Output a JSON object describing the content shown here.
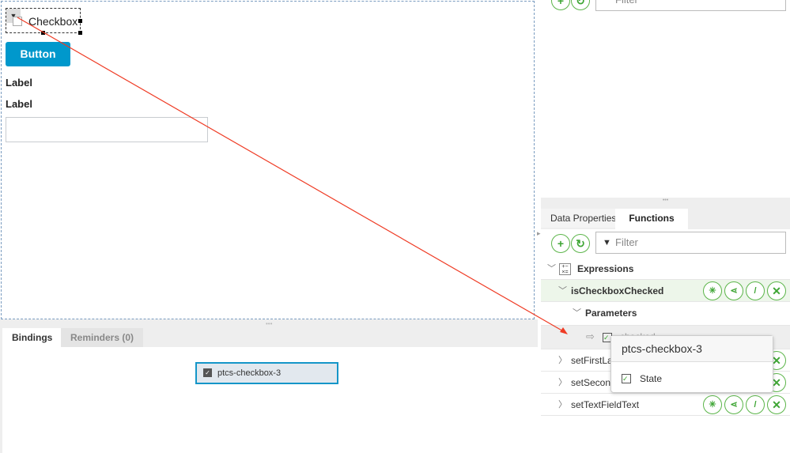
{
  "canvas": {
    "checkbox_label": "Checkbox",
    "button_label": "Button",
    "label1": "Label",
    "label2": "Label",
    "textfield_value": ""
  },
  "bottom": {
    "tabs": [
      {
        "label": "Bindings"
      },
      {
        "label": "Reminders (0)"
      }
    ],
    "binding_item": "ptcs-checkbox-3"
  },
  "right": {
    "tabs": [
      {
        "label": "Data Properties"
      },
      {
        "label": "Functions"
      }
    ],
    "filter_placeholder": "Filter",
    "tree": {
      "group": "Expressions",
      "functions": [
        "isCheckboxChecked",
        "setFirstLabelText",
        "setSecondLabelText",
        "setTextFieldText"
      ],
      "parameters_label": "Parameters",
      "param_name": "checked"
    }
  },
  "popup": {
    "title": "ptcs-checkbox-3",
    "item": "State"
  },
  "colors": {
    "accent": "#0098cc",
    "green": "#5cb54a",
    "arrow": "#ef3b24"
  }
}
